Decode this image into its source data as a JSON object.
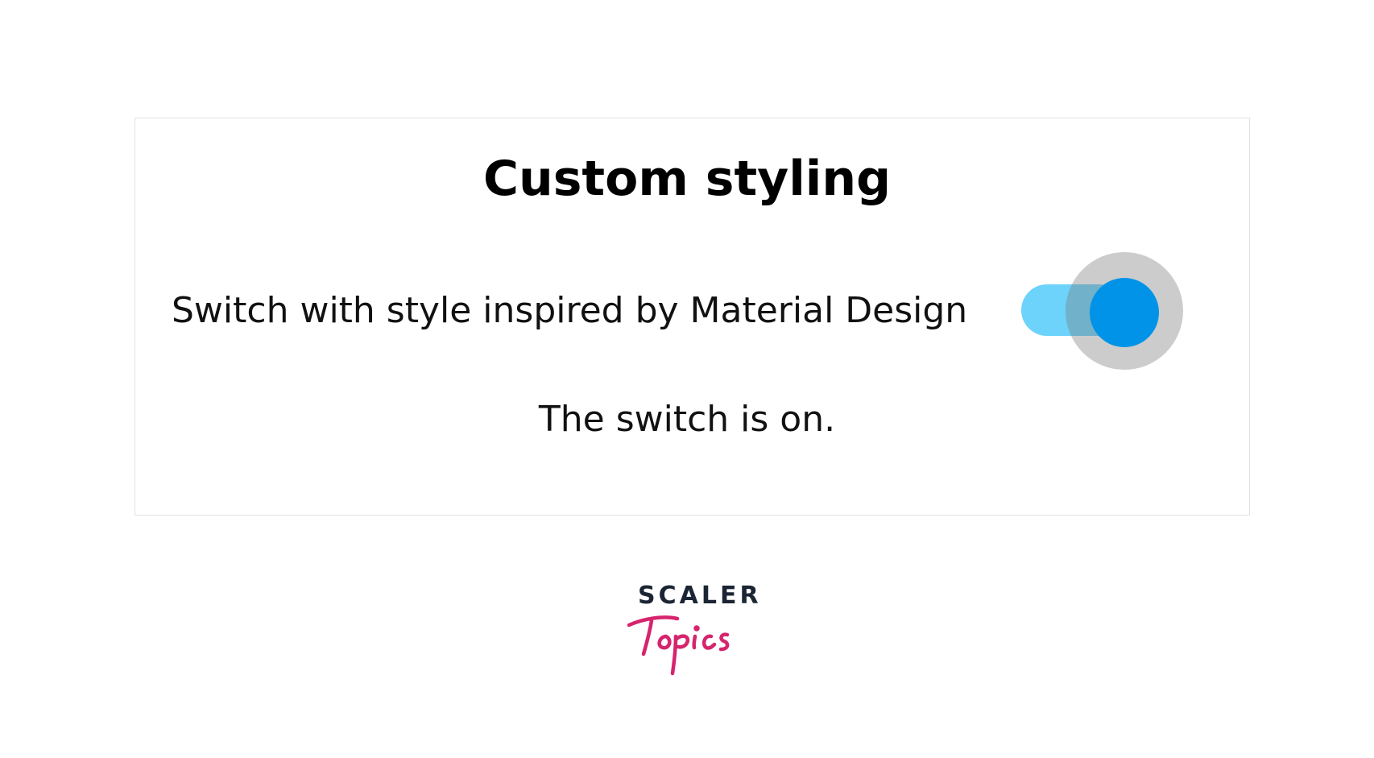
{
  "card": {
    "title": "Custom styling",
    "switch_label": "Switch with style inspired by Material Design",
    "switch_state": "on",
    "status_text": "The switch is on."
  },
  "colors": {
    "track": "#6dd3fb",
    "thumb": "#0093e8",
    "logo_dark": "#1b2533",
    "logo_accent": "#d6246e"
  },
  "brand": {
    "word": "SCALER",
    "script_word": "Topics"
  }
}
